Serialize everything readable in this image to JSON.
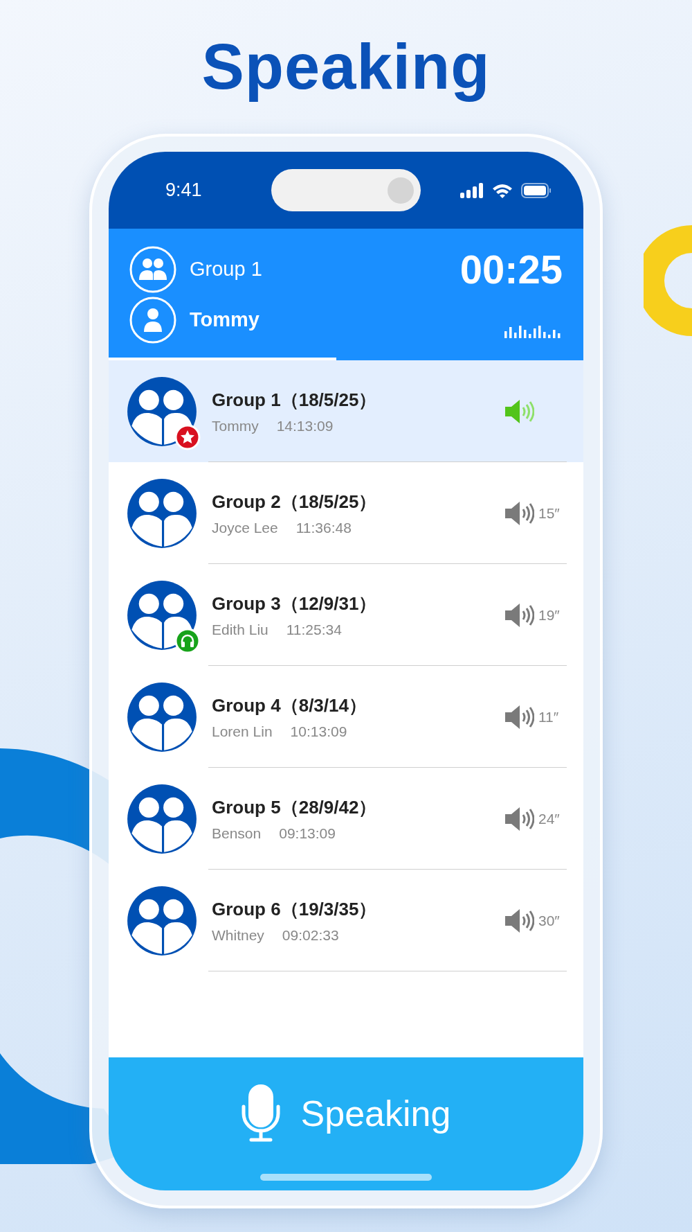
{
  "headline": "Speaking",
  "status_bar": {
    "time": "9:41"
  },
  "header": {
    "group": "Group 1",
    "speaker": "Tommy",
    "timer": "00:25",
    "progress": {
      "level": 0.48
    }
  },
  "groups": [
    {
      "kind": "starred",
      "title": "Group 1（18/5/25）",
      "speaker": "Tommy",
      "time": "14:13:09",
      "selected": true,
      "playing": true
    },
    {
      "kind": "plain",
      "title": "Group 2（18/5/25）",
      "speaker": "Joyce Lee",
      "time": "11:36:48",
      "selected": false,
      "playing": false,
      "duration": "15″"
    },
    {
      "kind": "listening",
      "title": "Group 3（12/9/31）",
      "speaker": "Edith Liu",
      "time": "11:25:34",
      "selected": false,
      "playing": false,
      "duration": "19″"
    },
    {
      "kind": "plain",
      "title": "Group 4（8/3/14）",
      "speaker": "Loren Lin",
      "time": "10:13:09",
      "selected": false,
      "playing": false,
      "duration": "11″"
    },
    {
      "kind": "plain",
      "title": "Group 5（28/9/42）",
      "speaker": "Benson",
      "time": "09:13:09",
      "selected": false,
      "playing": false,
      "duration": "24″"
    },
    {
      "kind": "plain",
      "title": "Group 6（19/3/35）",
      "speaker": "Whitney",
      "time": "09:02:33",
      "selected": false,
      "playing": false,
      "duration": "30″"
    }
  ],
  "talk_button": {
    "label": "Speaking"
  }
}
